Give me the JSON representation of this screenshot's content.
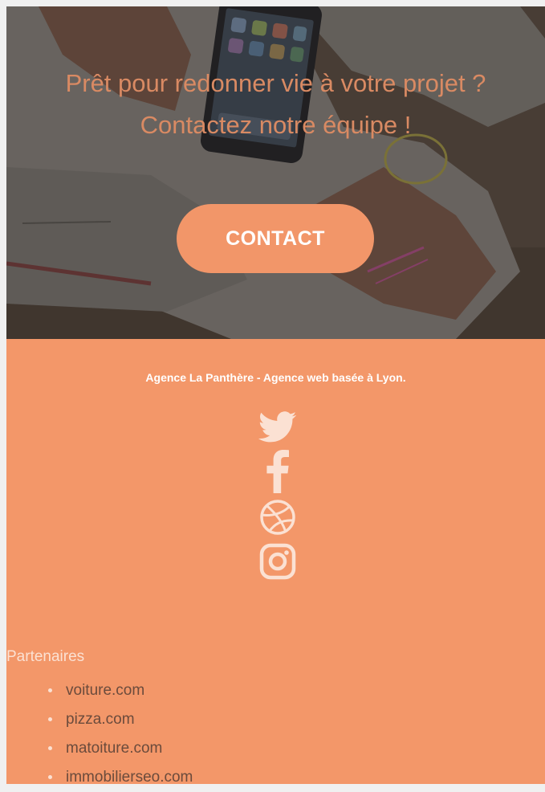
{
  "hero": {
    "title_line1": "Prêt pour redonner vie à votre projet ?",
    "title_line2": "Contactez notre équipe !",
    "contact_button": "CONTACT"
  },
  "footer": {
    "agency_text": "Agence La Panthère - Agence web basée à Lyon.",
    "social": [
      "twitter-icon",
      "facebook-icon",
      "dribbble-icon",
      "instagram-icon"
    ],
    "partners_title": "Partenaires",
    "partners": [
      "voiture.com",
      "pizza.com",
      "matoiture.com",
      "immobilierseo.com"
    ]
  },
  "colors": {
    "accent": "#f39769",
    "hero_text": "#d98a63",
    "icon": "#fbe1d3"
  }
}
